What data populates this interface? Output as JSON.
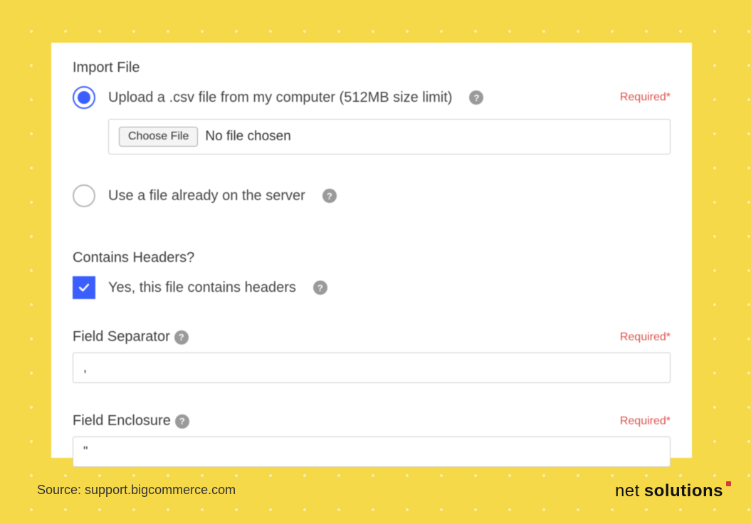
{
  "importFile": {
    "title": "Import File",
    "uploadOption": {
      "label": "Upload a .csv file from my computer (512MB size limit)",
      "required": "Required*",
      "chooseBtn": "Choose File",
      "fileStatus": "No file chosen"
    },
    "serverOption": {
      "label": "Use a file already on the server"
    }
  },
  "containsHeaders": {
    "title": "Contains Headers?",
    "checkboxLabel": "Yes, this file contains headers"
  },
  "fieldSeparator": {
    "label": "Field Separator",
    "required": "Required*",
    "value": ","
  },
  "fieldEnclosure": {
    "label": "Field Enclosure",
    "required": "Required*",
    "value": "\""
  },
  "source": "Source: support.bigcommerce.com",
  "brand": {
    "part1": "net",
    "part2": "solutions"
  }
}
